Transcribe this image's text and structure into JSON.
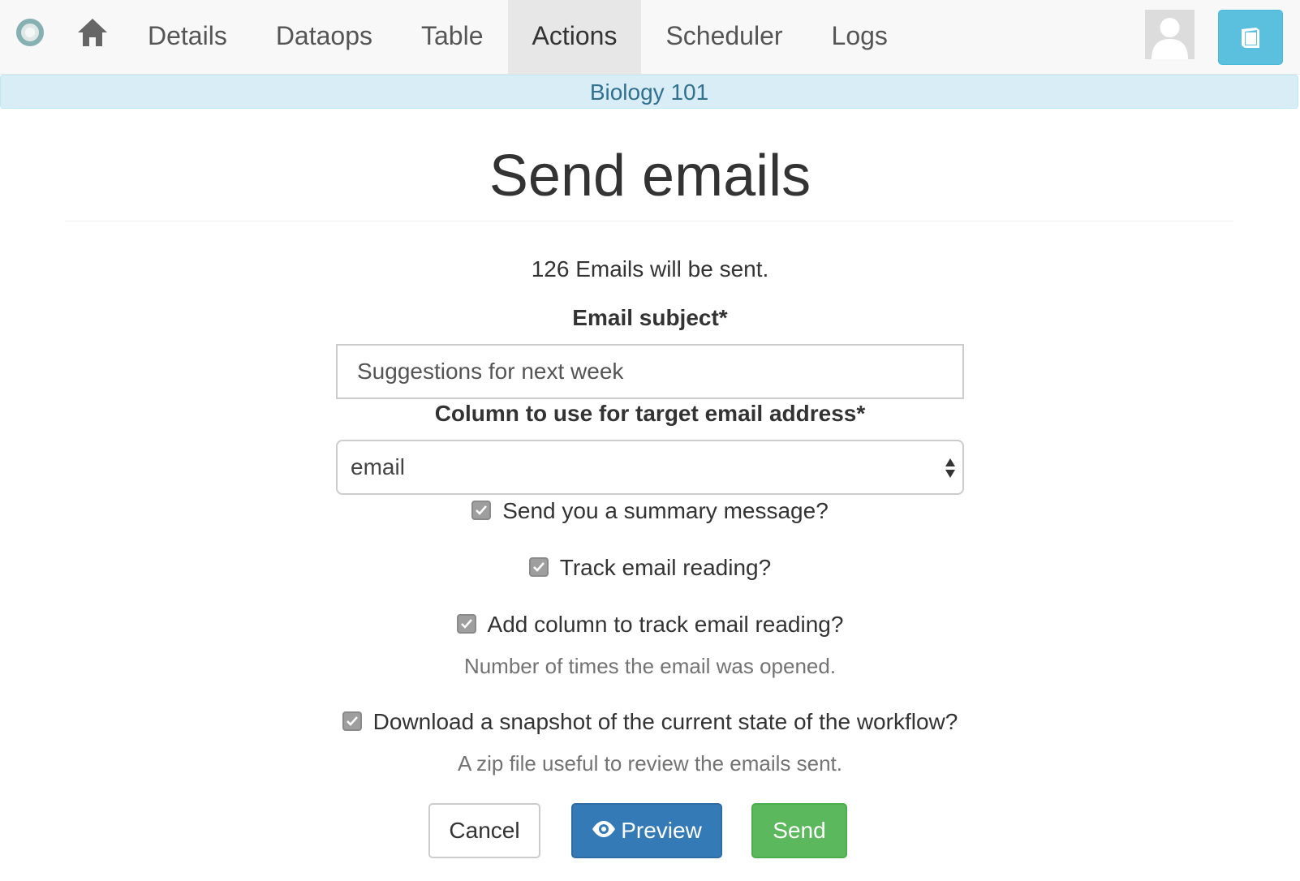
{
  "nav": {
    "tabs": [
      {
        "label": "Details"
      },
      {
        "label": "Dataops"
      },
      {
        "label": "Table"
      },
      {
        "label": "Actions",
        "active": true
      },
      {
        "label": "Scheduler"
      },
      {
        "label": "Logs"
      }
    ]
  },
  "banner": {
    "workflow_name": "Biology 101"
  },
  "page": {
    "title": "Send emails",
    "count_text": "126 Emails will be sent."
  },
  "form": {
    "subject_label": "Email subject*",
    "subject_value": "Suggestions for next week",
    "column_label": "Column to use for target email address*",
    "column_value": "email",
    "checkboxes": [
      {
        "label": "Send you a summary message?",
        "checked": true
      },
      {
        "label": "Track email reading?",
        "checked": true
      },
      {
        "label": "Add column to track email reading?",
        "checked": true,
        "help": "Number of times the email was opened."
      },
      {
        "label": "Download a snapshot of the current state of the workflow?",
        "checked": true,
        "help": "A zip file useful to review the emails sent."
      }
    ]
  },
  "buttons": {
    "cancel": "Cancel",
    "preview": "Preview",
    "send": "Send"
  },
  "colors": {
    "primary": "#337ab7",
    "success": "#5cb85c",
    "info": "#5bc0de",
    "banner_bg": "#d9edf7",
    "banner_text": "#31708f"
  },
  "icons": [
    "logo-icon",
    "home-icon",
    "avatar-icon",
    "book-icon",
    "eye-icon",
    "check-icon",
    "select-arrows-icon"
  ]
}
